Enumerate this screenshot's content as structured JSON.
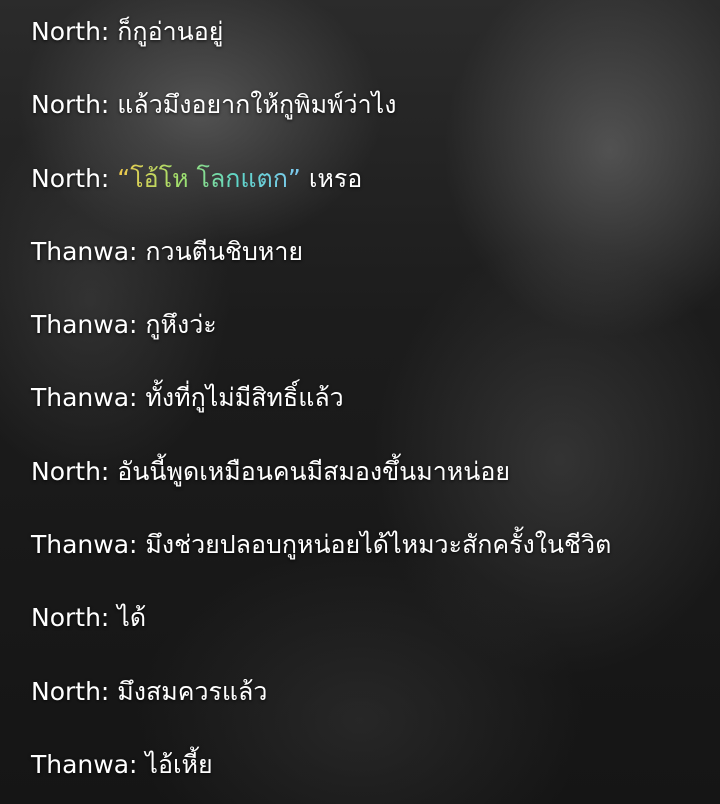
{
  "background": {
    "description_color": "#1c1c1c"
  },
  "colors": {
    "text": "#ffffff",
    "quote_gradient": [
      "#f2c94c",
      "#9fe06d",
      "#5fd6c9",
      "#7ec8f0"
    ]
  },
  "messages": [
    {
      "speaker": "North",
      "sep": ": ",
      "text": "ก็กูอ่านอยู่"
    },
    {
      "speaker": "North",
      "sep": ": ",
      "text": "แล้วมึงอยากให้กูพิมพ์ว่าไง"
    },
    {
      "speaker": "North",
      "sep": ": ",
      "quote": "“โอ้โห โลกแตก”",
      "text": " เหรอ"
    },
    {
      "speaker": "Thanwa",
      "sep": ": ",
      "text": "กวนตีนชิบหาย"
    },
    {
      "speaker": "Thanwa",
      "sep": ": ",
      "text": "กูหึงว่ะ"
    },
    {
      "speaker": "Thanwa",
      "sep": ": ",
      "text": "ทั้งที่กูไม่มีสิทธิ์แล้ว"
    },
    {
      "speaker": "North",
      "sep": ": ",
      "text": "อันนี้พูดเหมือนคนมีสมองขึ้นมาหน่อย"
    },
    {
      "speaker": "Thanwa",
      "sep": ": ",
      "text": "มึงช่วยปลอบกูหน่อยได้ไหมวะสักครั้งในชีวิต"
    },
    {
      "speaker": "North",
      "sep": ": ",
      "text": "ได้"
    },
    {
      "speaker": "North",
      "sep": ": ",
      "text": "มึงสมควรแล้ว"
    },
    {
      "speaker": "Thanwa",
      "sep": ": ",
      "text": "ไอ้เหี้ย"
    }
  ]
}
